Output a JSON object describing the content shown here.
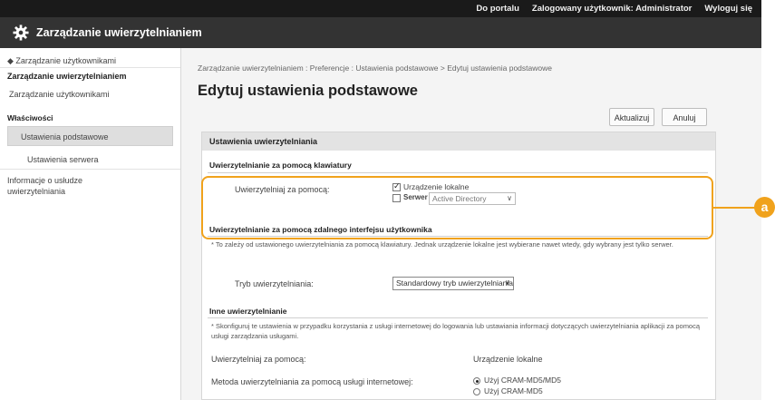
{
  "topbar": {
    "links": [
      "Do portalu",
      "Zalogowany użytkownik: Administrator",
      "Wyloguj się"
    ]
  },
  "app": {
    "title": "Zarządzanie uwierzytelnianiem",
    "icon": "gear-icon"
  },
  "sidebar": {
    "back": "◆ Zarządzanie użytkownikami",
    "heading": "Zarządzanie uwierzytelnianiem",
    "item_users": "Zarządzanie użytkownikami",
    "section": "Właściwości",
    "item_basic": "Ustawienia podstawowe",
    "item_server": "Ustawienia serwera",
    "item_info": "Informacje o usłudze uwierzytelniania"
  },
  "main": {
    "breadcrumb": "Zarządzanie uwierzytelnianiem : Preferencje : Ustawienia podstawowe > Edytuj ustawienia podstawowe",
    "title": "Edytuj ustawienia podstawowe",
    "btn_update": "Aktualizuj",
    "btn_cancel": "Anuluj",
    "panel_title": "Ustawienia uwierzytelniania",
    "kbd": {
      "heading": "Uwierzytelnianie za pomocą klawiatury",
      "auth_label": "Uwierzytelniaj za pomocą:",
      "local_device": "Urządzenie lokalne",
      "server": "Serwer",
      "server_select": "Active Directory"
    },
    "remote": {
      "heading": "Uwierzytelnianie za pomocą zdalnego interfejsu użytkownika",
      "note": "* To zależy od ustawionego uwierzytelniania za pomocą klawiatury. Jednak urządzenie lokalne jest wybierane nawet wtedy, gdy wybrany jest tylko serwer.",
      "mode_label": "Tryb uwierzytelniania:",
      "mode_value": "Standardowy tryb uwierzytelniania"
    },
    "other": {
      "heading": "Inne uwierzytelnianie",
      "note": "* Skonfiguruj te ustawienia w przypadku korzystania z usługi internetowej do logowania lub ustawiania informacji dotyczących uwierzytelniania aplikacji za pomocą usługi zarządzania usługami.",
      "auth_label": "Uwierzytelniaj za pomocą:",
      "auth_value": "Urządzenie lokalne",
      "method_label": "Metoda uwierzytelniania za pomocą usługi internetowej:",
      "opt1": "Użyj CRAM-MD5/MD5",
      "opt2": "Użyj CRAM-MD5"
    }
  },
  "callout": {
    "label": "a",
    "color": "#f0a21c"
  }
}
